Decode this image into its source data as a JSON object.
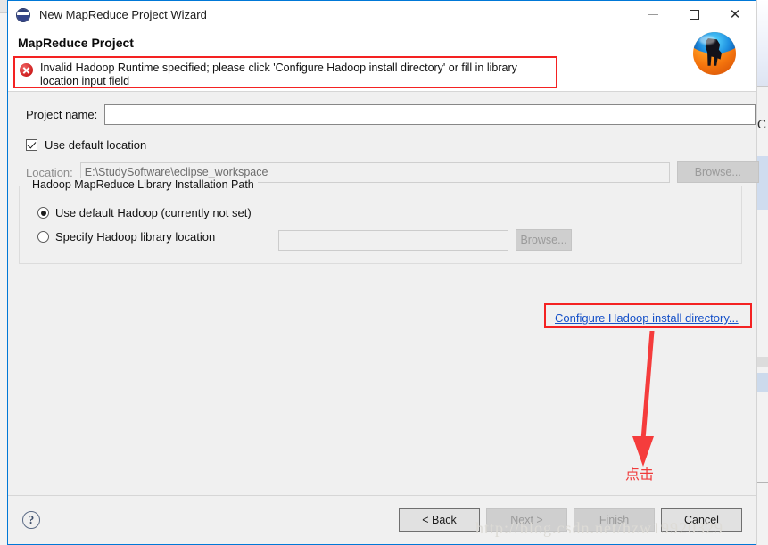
{
  "window": {
    "title": "New MapReduce Project Wizard",
    "icon": "eclipse-icon",
    "minimize_label": "—",
    "maximize_label": "□",
    "close_label": "✕"
  },
  "header": {
    "heading": "MapReduce Project",
    "error_message": "Invalid Hadoop Runtime specified; please click 'Configure Hadoop install directory' or fill in library location input field",
    "error_border_color": "#f42222",
    "logo": "hadoop-elephant-sphere-icon"
  },
  "form": {
    "project_name_label": "Project name:",
    "project_name_value": "",
    "use_default_location_label": "Use default location",
    "use_default_location_checked": true,
    "location_label": "Location:",
    "location_value": "E:\\StudySoftware\\eclipse_workspace",
    "location_browse_label": "Browse...",
    "location_browse_enabled": false
  },
  "hadoop_group": {
    "title": "Hadoop MapReduce Library Installation Path",
    "option_default_label": "Use default Hadoop (currently not set)",
    "option_default_selected": true,
    "option_specify_label": "Specify Hadoop library location",
    "option_specify_selected": false,
    "library_path_value": "",
    "library_browse_label": "Browse...",
    "library_browse_enabled": false,
    "configure_link_label": "Configure Hadoop install directory...",
    "configure_link_color": "#1550c8"
  },
  "annotation": {
    "text": "点击",
    "color": "#f03a3a",
    "arrow": "down-arrow"
  },
  "footer": {
    "help_label": "?",
    "back_label": "< Back",
    "next_label": "Next >",
    "finish_label": "Finish",
    "cancel_label": "Cancel",
    "back_enabled": true,
    "next_enabled": false,
    "finish_enabled": false,
    "cancel_enabled": true
  },
  "watermark": {
    "text": "http://blog.csdn.net/hzw19920329"
  },
  "background": {
    "peek_letter": "C"
  }
}
